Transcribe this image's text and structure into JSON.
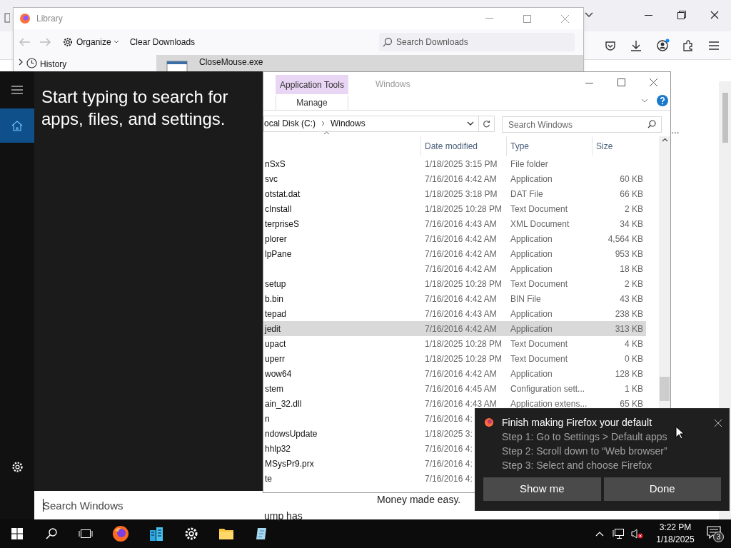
{
  "browser": {
    "texts": [
      {
        "kind": "ellipsis",
        "text": "..."
      },
      {
        "kind": "tagline",
        "text": "Money made easy."
      },
      {
        "kind": "snippet",
        "text": "ump has"
      }
    ]
  },
  "library": {
    "title": "Library",
    "organize": "Organize",
    "clear": "Clear Downloads",
    "search": {
      "placeholder": "Search Downloads"
    },
    "sidebar": [
      {
        "label": "History"
      }
    ],
    "downloads": [
      {
        "name": "CloseMouse.exe"
      }
    ]
  },
  "explorer": {
    "ribbon_group": "Application Tools",
    "ribbon_tab": "Manage",
    "title": "Windows",
    "breadcrumb": [
      "ocal Disk (C:)",
      "Windows"
    ],
    "search": {
      "placeholder": "Search Windows"
    },
    "columns": [
      "Date modified",
      "Type",
      "Size"
    ],
    "rows": [
      {
        "name": "nSxS",
        "date": "1/18/2025 3:15 PM",
        "type": "File folder",
        "size": "",
        "selected": false
      },
      {
        "name": "svc",
        "date": "7/16/2016 4:42 AM",
        "type": "Application",
        "size": "60 KB",
        "selected": false
      },
      {
        "name": "otstat.dat",
        "date": "1/18/2025 3:18 PM",
        "type": "DAT File",
        "size": "66 KB",
        "selected": false
      },
      {
        "name": "cInstall",
        "date": "1/18/2025 10:28 PM",
        "type": "Text Document",
        "size": "2 KB",
        "selected": false
      },
      {
        "name": "terpriseS",
        "date": "7/16/2016 4:43 AM",
        "type": "XML Document",
        "size": "34 KB",
        "selected": false
      },
      {
        "name": "plorer",
        "date": "7/16/2016 4:42 AM",
        "type": "Application",
        "size": "4,564 KB",
        "selected": false
      },
      {
        "name": "lpPane",
        "date": "7/16/2016 4:42 AM",
        "type": "Application",
        "size": "953 KB",
        "selected": false
      },
      {
        "name": "",
        "date": "7/16/2016 4:42 AM",
        "type": "Application",
        "size": "18 KB",
        "selected": false
      },
      {
        "name": "setup",
        "date": "1/18/2025 10:28 PM",
        "type": "Text Document",
        "size": "2 KB",
        "selected": false
      },
      {
        "name": "b.bin",
        "date": "7/16/2016 4:42 AM",
        "type": "BIN File",
        "size": "43 KB",
        "selected": false
      },
      {
        "name": "tepad",
        "date": "7/16/2016 4:43 AM",
        "type": "Application",
        "size": "238 KB",
        "selected": false
      },
      {
        "name": "jedit",
        "date": "7/16/2016 4:42 AM",
        "type": "Application",
        "size": "313 KB",
        "selected": true
      },
      {
        "name": "upact",
        "date": "1/18/2025 10:28 PM",
        "type": "Text Document",
        "size": "4 KB",
        "selected": false
      },
      {
        "name": "uperr",
        "date": "1/18/2025 10:28 PM",
        "type": "Text Document",
        "size": "0 KB",
        "selected": false
      },
      {
        "name": "wow64",
        "date": "7/16/2016 4:42 AM",
        "type": "Application",
        "size": "128 KB",
        "selected": false
      },
      {
        "name": "stem",
        "date": "7/16/2016 4:45 AM",
        "type": "Configuration sett...",
        "size": "1 KB",
        "selected": false
      },
      {
        "name": "ain_32.dll",
        "date": "7/16/2016 4:43 AM",
        "type": "Application extens...",
        "size": "65 KB",
        "selected": false
      },
      {
        "name": "n",
        "date": "7/16/2016 4:",
        "type": "",
        "size": "",
        "selected": false
      },
      {
        "name": "ndowsUpdate",
        "date": "1/18/2025 3:",
        "type": "",
        "size": "",
        "selected": false
      },
      {
        "name": "hhlp32",
        "date": "7/16/2016 4:",
        "type": "",
        "size": "",
        "selected": false
      },
      {
        "name": "MSysPr9.prx",
        "date": "7/16/2016 4:",
        "type": "",
        "size": "",
        "selected": false
      },
      {
        "name": "te",
        "date": "7/16/2016 4:",
        "type": "",
        "size": "",
        "selected": false
      }
    ]
  },
  "start_menu": {
    "prompt": "Start typing to search for apps, files, and settings.",
    "nav": [
      {
        "kind": "home",
        "selected": true
      }
    ],
    "search": {
      "placeholder": "Search Windows"
    }
  },
  "notification": {
    "title": "Finish making Firefox your default",
    "lines": [
      "Step 1: Go to Settings > Default apps",
      "Step 2: Scroll down to “Web browser”",
      "Step 3: Select and choose Firefox"
    ],
    "buttons": [
      "Show me",
      "Done"
    ]
  },
  "taskbar": {
    "time": "3:22 PM",
    "date": "1/18/2025",
    "notification_count": "3"
  }
}
